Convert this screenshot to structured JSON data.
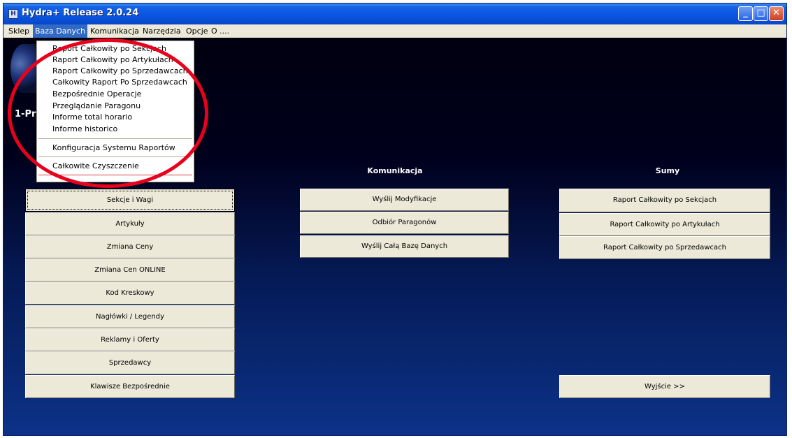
{
  "window": {
    "title": "Hydra+ Release 2.0.24"
  },
  "menu": [
    "Sklep",
    "Baza Danych",
    "Komunikacja",
    "Narzędzia",
    "Opcje",
    "O ...."
  ],
  "dropdown": {
    "items": [
      "Raport Całkowity po Sekcjach",
      "Raport Całkowity po Artykułach",
      "Raport Całkowity po Sprzedawcach",
      "Całkowity Raport Po Sprzedawcach",
      "Bezpośrednie Operacje",
      "Przeglądanie Paragonu",
      "Informe total horario",
      "Informe historico",
      "Konfiguracja Systemu Raportów",
      "Całkowite Czyszczenie"
    ]
  },
  "brand": "1-Pr",
  "sections": {
    "comm": "Komunikacja",
    "sums": "Sumy"
  },
  "left_buttons": [
    "Sekcje i Wagi",
    "Artykuły",
    "Zmiana Ceny",
    "Zmiana Cen ONLINE",
    "Kod Kreskowy",
    "Nagłówki / Legendy",
    "Reklamy i Oferty",
    "Sprzedawcy",
    "Klawisze Bezpośrednie"
  ],
  "comm_buttons": [
    "Wyślij Modyfikacje",
    "Odbiór Paragonów",
    "Wyślij Całą Bazę Danych"
  ],
  "sum_buttons": [
    "Raport Całkowity po Sekcjach",
    "Raport Całkowity po Artykułach",
    "Raport Całkowity po Sprzedawcach"
  ],
  "exit_button": "Wyjście >>",
  "colors": {
    "accent_red": "#e8001c",
    "menu_highlight": "#316ac5"
  }
}
